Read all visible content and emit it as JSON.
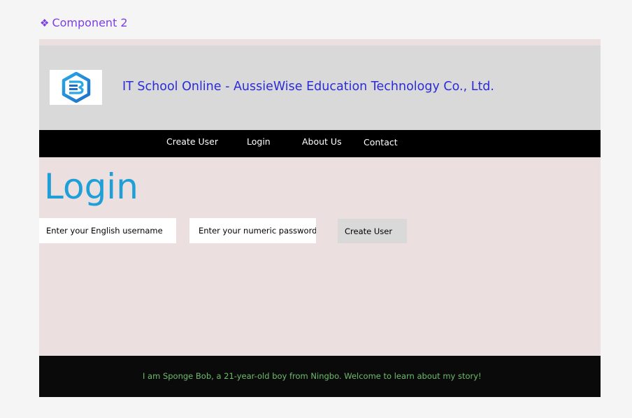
{
  "component": {
    "label": "Component 2",
    "icon": "component-diamond-icon",
    "color": "#7b3fe4"
  },
  "header": {
    "logo_icon": "aussiewise-logo-icon",
    "title": "IT School Online - AussieWise Education Technology Co., Ltd.",
    "title_color": "#2b2bdb"
  },
  "nav": {
    "items": [
      {
        "label": "Create User"
      },
      {
        "label": "Login"
      },
      {
        "label": "About Us"
      },
      {
        "label": "Contact"
      }
    ]
  },
  "main": {
    "title": "Login",
    "title_color": "#1e9fd8",
    "username_placeholder": "Enter your English username",
    "password_placeholder": "Enter your numeric password",
    "submit_label": "Create User"
  },
  "footer": {
    "text": "I am Sponge Bob, a 21-year-old boy from Ningbo. Welcome to learn about my story!",
    "text_color": "#6dbb6d"
  }
}
